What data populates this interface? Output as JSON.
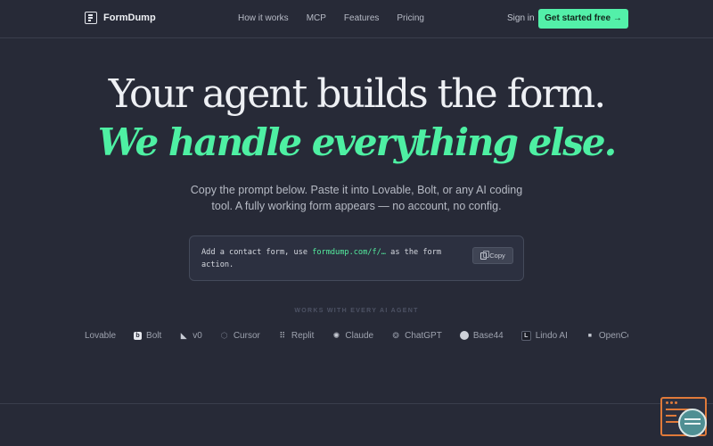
{
  "brand": {
    "name": "FormDump"
  },
  "nav": {
    "links": [
      "How it works",
      "MCP",
      "Features",
      "Pricing"
    ],
    "signin": "Sign in",
    "cta": "Get started free →"
  },
  "hero": {
    "headline": "Your agent builds the form.",
    "tagline": "We handle everything else.",
    "subtitle": "Copy the prompt below. Paste it into Lovable, Bolt, or any AI coding tool. A fully working form appears — no account, no config."
  },
  "prompt": {
    "before": "Add a contact form, use ",
    "url": "formdump.com/f/…",
    "after": " as the form action.",
    "copy_label": "Copy"
  },
  "works_with": {
    "label": "WORKS WITH EVERY AI AGENT",
    "agents": [
      {
        "name": "Lovable",
        "icon": "none"
      },
      {
        "name": "Bolt",
        "icon": "bolt-icon"
      },
      {
        "name": "v0",
        "icon": "v0-icon"
      },
      {
        "name": "Cursor",
        "icon": "cursor-icon"
      },
      {
        "name": "Replit",
        "icon": "replit-icon"
      },
      {
        "name": "Claude",
        "icon": "claude-icon"
      },
      {
        "name": "ChatGPT",
        "icon": "chatgpt-icon"
      },
      {
        "name": "Base44",
        "icon": "base44-icon"
      },
      {
        "name": "Lindo AI",
        "icon": "lindo-icon"
      },
      {
        "name": "OpenCode",
        "icon": "opencode-icon"
      }
    ]
  },
  "colors": {
    "background": "#272a37",
    "accent": "#53f0a9",
    "widget": "#e07a3a"
  }
}
